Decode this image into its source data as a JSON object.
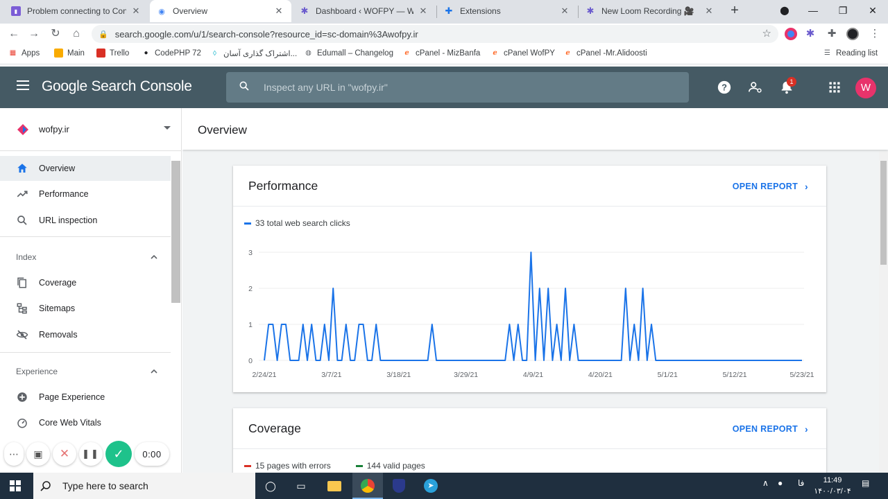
{
  "browser": {
    "tabs": [
      {
        "title": "Problem connecting to Console",
        "active": false
      },
      {
        "title": "Overview",
        "active": true
      },
      {
        "title": "Dashboard ‹ WOFPY — WordPress",
        "active": false
      },
      {
        "title": "Extensions",
        "active": false
      },
      {
        "title": "New Loom Recording 🎥",
        "active": false
      }
    ],
    "url": "search.google.com/u/1/search-console?resource_id=sc-domain%3Awofpy.ir",
    "bookmarks": [
      "Apps",
      "Main",
      "Trello",
      "CodePHP 72",
      "اشتراک گذاری آسان...",
      "Edumall – Changelog",
      "cPanel - MizBanfa",
      "cPanel WofPY",
      "cPanel -Mr.Alidoosti"
    ],
    "reading_list": "Reading list"
  },
  "header": {
    "title": "Google Search Console",
    "search_placeholder": "Inspect any URL in \"wofpy.ir\"",
    "notification_count": "1",
    "avatar_letter": "W"
  },
  "sidebar": {
    "property": "wofpy.ir",
    "items": [
      {
        "label": "Overview"
      },
      {
        "label": "Performance"
      },
      {
        "label": "URL inspection"
      }
    ],
    "sections": [
      {
        "label": "Index",
        "items": [
          {
            "label": "Coverage"
          },
          {
            "label": "Sitemaps"
          },
          {
            "label": "Removals"
          }
        ]
      },
      {
        "label": "Experience",
        "items": [
          {
            "label": "Page Experience"
          },
          {
            "label": "Core Web Vitals"
          }
        ]
      }
    ]
  },
  "main": {
    "page_title": "Overview",
    "performance": {
      "title": "Performance",
      "open_report": "OPEN REPORT",
      "legend": "33 total web search clicks",
      "color": "#1a73e8"
    },
    "coverage": {
      "title": "Coverage",
      "open_report": "OPEN REPORT",
      "legend_errors": "15 pages with errors",
      "legend_valid": "144 valid pages",
      "error_color": "#d93025",
      "valid_color": "#188038"
    }
  },
  "chart_data": {
    "type": "line",
    "series": [
      {
        "values": [
          0,
          1,
          1,
          0,
          1,
          1,
          0,
          0,
          0,
          1,
          0,
          1,
          0,
          0,
          1,
          0,
          2,
          0,
          0,
          1,
          0,
          0,
          1,
          1,
          0,
          0,
          1,
          0,
          0,
          0,
          0,
          0,
          0,
          0,
          0,
          0,
          0,
          0,
          0,
          1,
          0,
          0,
          0,
          0,
          0,
          0,
          0,
          0,
          0,
          0,
          0,
          0,
          0,
          0,
          0,
          0,
          0,
          1,
          0,
          1,
          0,
          0,
          3,
          0,
          2,
          0,
          2,
          0,
          1,
          0,
          2,
          0,
          1,
          0,
          0,
          0,
          0,
          0,
          0,
          0,
          0,
          0,
          0,
          0,
          2,
          0,
          1,
          0,
          2,
          0,
          1,
          0,
          0,
          0,
          0,
          0,
          0,
          0,
          0,
          0,
          0,
          0,
          0,
          0,
          0,
          0,
          0,
          0,
          0,
          0,
          0,
          0,
          0,
          0,
          0,
          0,
          0,
          0,
          0,
          0,
          0,
          0,
          0,
          0,
          0,
          0
        ]
      }
    ],
    "x_ticks": [
      "2/24/21",
      "3/7/21",
      "3/18/21",
      "3/29/21",
      "4/9/21",
      "4/20/21",
      "5/1/21",
      "5/12/21",
      "5/23/21"
    ],
    "y_ticks": [
      0,
      1,
      2,
      3
    ],
    "ylim": [
      0,
      3
    ],
    "grid": true
  },
  "loom": {
    "timer": "0:00"
  },
  "taskbar": {
    "search_text": "Type here to search",
    "time": "11:49",
    "date": "۱۴۰۰/۰۳/۰۴",
    "lang": "فا"
  }
}
